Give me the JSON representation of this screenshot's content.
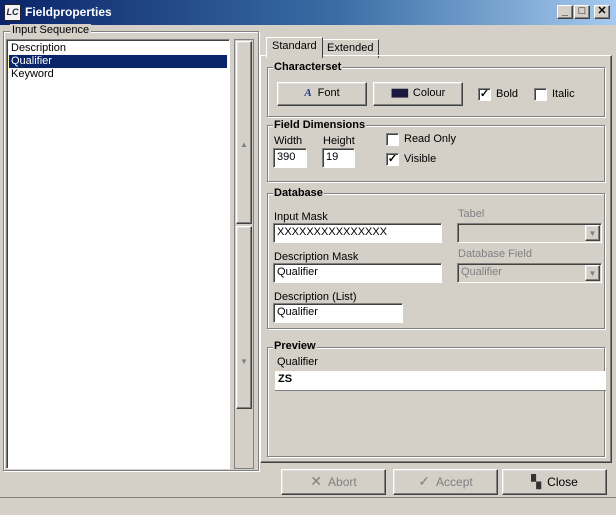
{
  "window": {
    "title": "Fieldproperties",
    "icon_label": "LC",
    "controls": {
      "minimize": "_",
      "maximize": "□",
      "close": "✕"
    }
  },
  "input_sequence": {
    "caption": "Input Sequence",
    "items": [
      "Description",
      "Qualifier",
      "Keyword"
    ],
    "selected_index": 1
  },
  "tabs": [
    "Standard",
    "Extended"
  ],
  "active_tab": "Standard",
  "characterset": {
    "caption": "Characterset",
    "font_button": "Font",
    "colour_button": "Colour",
    "bold_label": "Bold",
    "bold_checked": true,
    "italic_label": "Italic",
    "italic_checked": false
  },
  "field_dimensions": {
    "caption": "Field Dimensions",
    "width_label": "Width",
    "width_value": "390",
    "height_label": "Height",
    "height_value": "19",
    "readonly_label": "Read Only",
    "readonly_checked": false,
    "visible_label": "Visible",
    "visible_checked": true
  },
  "database": {
    "caption": "Database",
    "input_mask_label": "Input Mask",
    "input_mask_value": "XXXXXXXXXXXXXXX",
    "tabel_label": "Tabel",
    "tabel_value": "",
    "description_mask_label": "Description Mask",
    "description_mask_value": "Qualifier",
    "database_field_label": "Database Field",
    "database_field_value": "Qualifier",
    "description_list_label": "Description (List)",
    "description_list_value": "Qualifier"
  },
  "preview": {
    "caption": "Preview",
    "label": "Qualifier",
    "value": "ZS"
  },
  "buttons": {
    "abort": "Abort",
    "accept": "Accept",
    "close": "Close"
  },
  "icons": {
    "font": "font-a-icon",
    "colour": "crayons-icon",
    "abort": "x-icon",
    "accept": "check-icon",
    "close": "door-exit-icon"
  }
}
